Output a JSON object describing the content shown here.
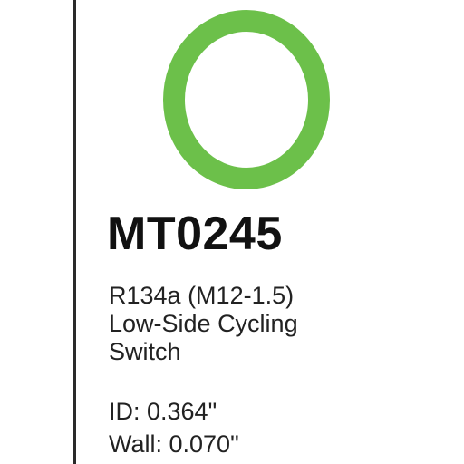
{
  "product": {
    "part_number": "MT0245",
    "ring_color": "#6cc04a",
    "description_lines": [
      "R134a (M12-1.5)",
      "Low-Side Cycling",
      "Switch"
    ],
    "specs": {
      "id_label": "ID: 0.364\"",
      "wall_label": "Wall: 0.070\""
    }
  },
  "icons": {
    "ring": "o-ring-icon"
  }
}
